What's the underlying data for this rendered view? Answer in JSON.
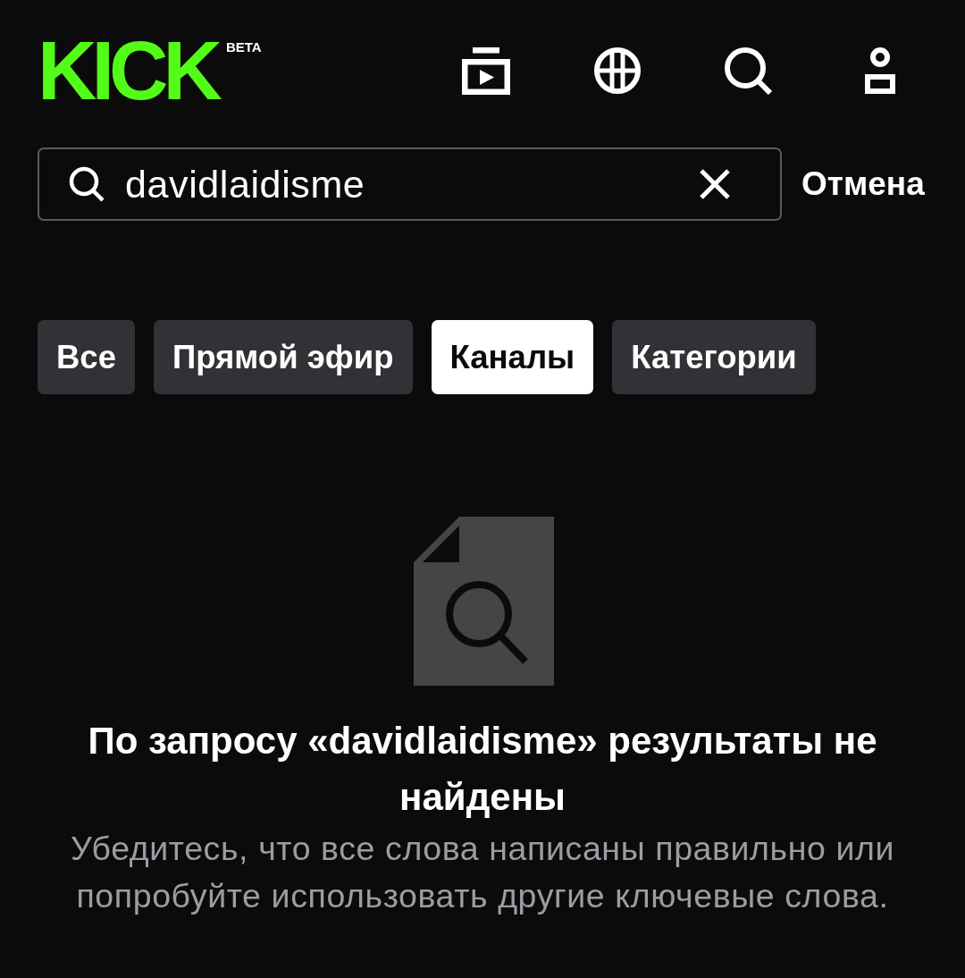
{
  "header": {
    "logo": "KICK",
    "badge": "BETA"
  },
  "search": {
    "value": "davidlaidisme",
    "cancel": "Отмена"
  },
  "tabs": [
    {
      "label": "Все",
      "selected": false
    },
    {
      "label": "Прямой эфир",
      "selected": false
    },
    {
      "label": "Каналы",
      "selected": true
    },
    {
      "label": "Категории",
      "selected": false
    }
  ],
  "empty_state": {
    "title": "По запросу «davidlaidisme» результаты не найдены",
    "message": "Убедитесь, что все слова написаны правильно или попробуйте использовать другие ключевые слова."
  }
}
